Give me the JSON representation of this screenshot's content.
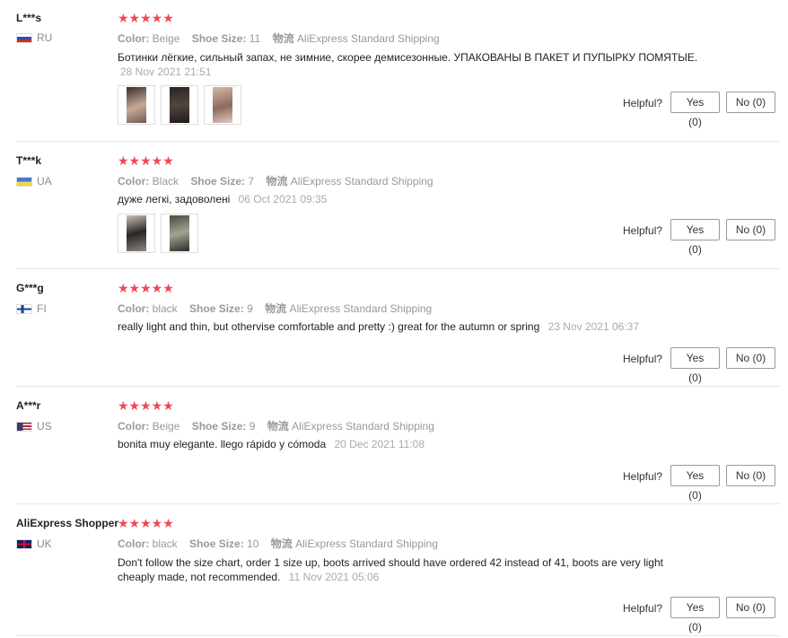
{
  "ui": {
    "helpful_label": "Helpful?"
  },
  "reviews": [
    {
      "user": "L***s",
      "country": "RU",
      "flag": "ru",
      "stars": "★★★★★",
      "color_label": "Color:",
      "color": "Beige",
      "size_label": "Shoe Size:",
      "size": "11",
      "ship_label": "物流",
      "shipping": "AliExpress Standard Shipping",
      "text": "Ботинки лёгкие, сильный запах, не зимние, скорее демисезонные. УПАКОВАНЫ В ПАКЕТ И ПУПЫРКУ ПОМЯТЫЕ.",
      "date": "28 Nov 2021 21:51",
      "yes": "Yes (0)",
      "no": "No (0)",
      "photos": [
        "boot-photo-1",
        "boot-photo-2",
        "boot-photo-3"
      ]
    },
    {
      "user": "T***k",
      "country": "UA",
      "flag": "ua",
      "stars": "★★★★★",
      "color_label": "Color:",
      "color": "Black",
      "size_label": "Shoe Size:",
      "size": "7",
      "ship_label": "物流",
      "shipping": "AliExpress Standard Shipping",
      "text": "дуже легкі, задоволені",
      "date": "06 Oct 2021 09:35",
      "yes": "Yes (0)",
      "no": "No (0)",
      "photos": [
        "boot-photo-1",
        "boot-photo-2"
      ]
    },
    {
      "user": "G***g",
      "country": "FI",
      "flag": "fi",
      "stars": "★★★★★",
      "color_label": "Color:",
      "color": "black",
      "size_label": "Shoe Size:",
      "size": "9",
      "ship_label": "物流",
      "shipping": "AliExpress Standard Shipping",
      "text": "really light and thin, but othervise comfortable and pretty :) great for the autumn or spring",
      "date": "23 Nov 2021 06:37",
      "yes": "Yes (0)",
      "no": "No (0)"
    },
    {
      "user": "A***r",
      "country": "US",
      "flag": "us",
      "stars": "★★★★★",
      "color_label": "Color:",
      "color": "Beige",
      "size_label": "Shoe Size:",
      "size": "9",
      "ship_label": "物流",
      "shipping": "AliExpress Standard Shipping",
      "text": "bonita muy elegante. llego rápido y cómoda",
      "date": "20 Dec 2021 11:08",
      "yes": "Yes (0)",
      "no": "No (0)"
    },
    {
      "user": "AliExpress Shopper",
      "country": "UK",
      "flag": "uk",
      "stars": "★★★★★",
      "color_label": "Color:",
      "color": "black",
      "size_label": "Shoe Size:",
      "size": "10",
      "ship_label": "物流",
      "shipping": "AliExpress Standard Shipping",
      "text": "Don't follow the size chart, order 1 size up, boots arrived should have ordered 42 instead of 41, boots are very light cheaply made, not recommended.",
      "date": "11 Nov 2021 05:06",
      "yes": "Yes (0)",
      "no": "No (0)"
    }
  ]
}
